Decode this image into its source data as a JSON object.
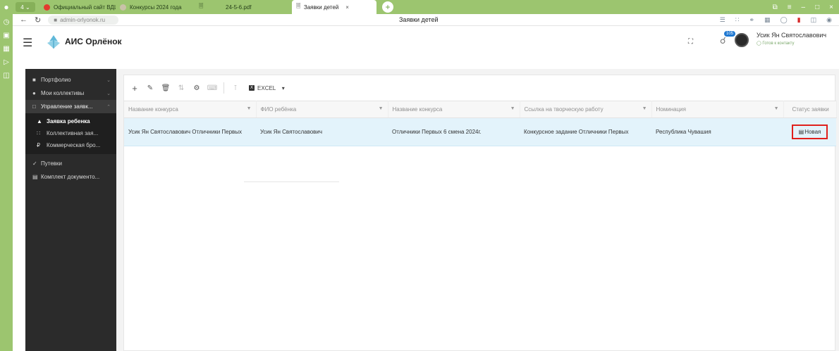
{
  "browser": {
    "workspace_label": "4",
    "tabs": [
      {
        "title": "Официальный сайт ВДЦ",
        "icon_color": "#e23b2e",
        "active": false
      },
      {
        "title": "Конкурсы 2024 года",
        "icon_color": "#c9c2a8",
        "active": false
      },
      {
        "title": "",
        "icon_color": "#ffffff",
        "active": false
      },
      {
        "title": "24-5-6.pdf",
        "icon_color": "#ffffff",
        "active": false
      },
      {
        "title": "Заявки детей",
        "icon_color": "#ffffff",
        "active": true
      }
    ],
    "url": "admin-orlyonok.ru",
    "page_title": "Заявки детей"
  },
  "header": {
    "brand": "АИС Орлёнок",
    "notification_count": "105",
    "user_name": "Усик Ян Святославович",
    "user_status": "Готов к контакту"
  },
  "sidebar": {
    "items": [
      {
        "label": "Портфолио",
        "icon": "briefcase-icon"
      },
      {
        "label": "Мои коллективы",
        "icon": "group-icon"
      },
      {
        "label": "Управление заявк...",
        "icon": "document-icon"
      }
    ],
    "subitems": [
      {
        "label": "Заявка ребенка",
        "icon": "child-icon"
      },
      {
        "label": "Коллективная зая...",
        "icon": "people-icon"
      },
      {
        "label": "Коммерческая бро...",
        "icon": "ruble-icon"
      }
    ],
    "bottom_items": [
      {
        "label": "Путевки",
        "icon": "ticket-icon"
      },
      {
        "label": "Комплект документо...",
        "icon": "id-card-icon"
      }
    ]
  },
  "toolbar": {
    "excel_label": "EXCEL"
  },
  "table": {
    "columns": [
      "Название конкурса",
      "ФИО ребёнка",
      "Название конкурса",
      "Ссылка на творческую работу",
      "Номинация",
      "Статус заявки"
    ],
    "rows": [
      [
        "Усик Ян Святославович Отличники Первых",
        "Усик Ян Святославович",
        "Отличники Первых 6 смена 2024г.",
        "Конкурсное задание Отличники Первых",
        "Республика Чувашия",
        "Новая"
      ]
    ]
  },
  "colors": {
    "browser_green": "#9cc56f",
    "sidebar_dark": "#2b2b2b",
    "selected_row": "#e3f3fb",
    "highlight_red": "#e0201c"
  }
}
